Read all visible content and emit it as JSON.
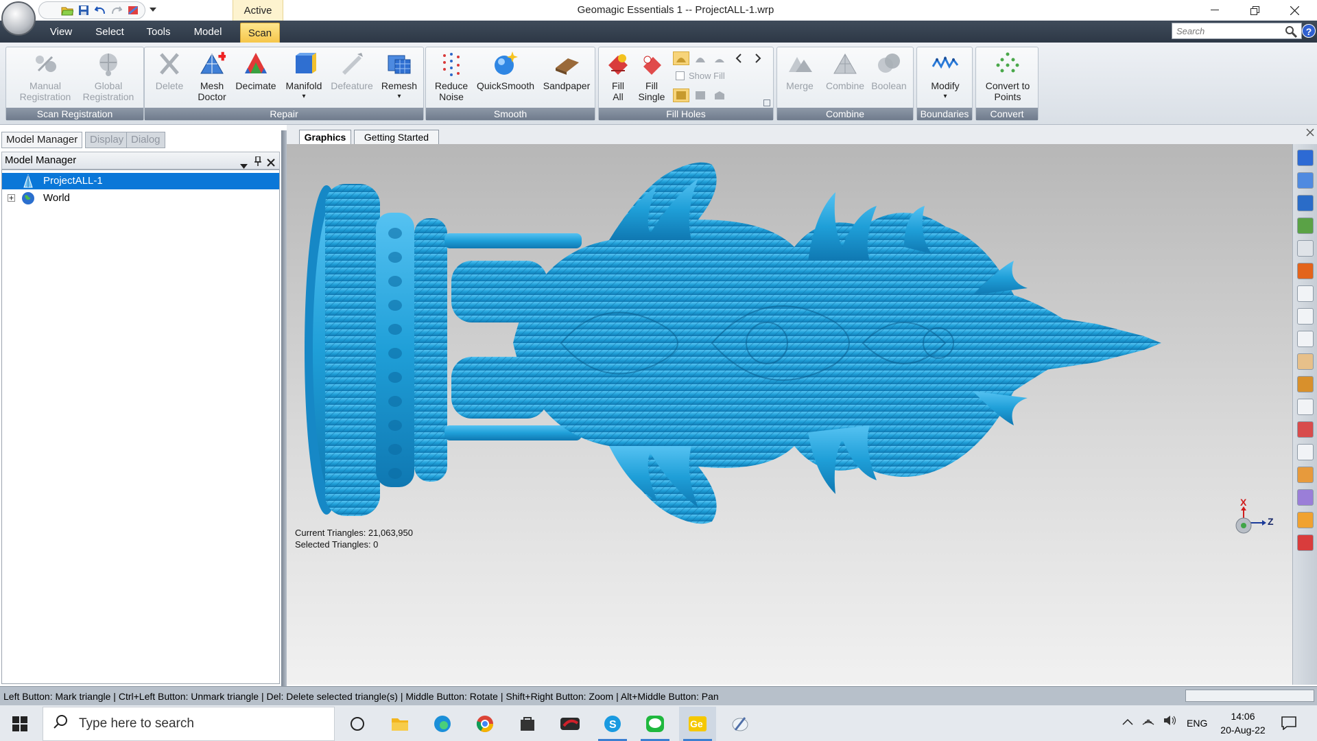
{
  "titlebar": {
    "context_tab": "Active",
    "window_title": "Geomagic Essentials 1 -- ProjectALL-1.wrp"
  },
  "menu": {
    "items": [
      "View",
      "Select",
      "Tools",
      "Model",
      "Scan"
    ],
    "selected": "Scan",
    "search_placeholder": "Search"
  },
  "ribbon": {
    "groups": [
      {
        "label": "Scan Registration",
        "buttons": [
          {
            "label": "Manual Registration",
            "line1": "Manual",
            "line2": "Registration",
            "icon": "manual-registration-icon",
            "enabled": false
          },
          {
            "label": "Global Registration",
            "line1": "Global",
            "line2": "Registration",
            "icon": "global-registration-icon",
            "enabled": false
          }
        ]
      },
      {
        "label": "Repair",
        "buttons": [
          {
            "label": "Delete",
            "line1": "Delete",
            "line2": "",
            "icon": "delete-icon",
            "enabled": false
          },
          {
            "label": "Mesh Doctor",
            "line1": "Mesh",
            "line2": "Doctor",
            "icon": "mesh-doctor-icon",
            "enabled": true
          },
          {
            "label": "Decimate",
            "line1": "Decimate",
            "line2": "",
            "icon": "decimate-icon",
            "enabled": true
          },
          {
            "label": "Manifold",
            "line1": "Manifold",
            "line2": "▾",
            "icon": "manifold-icon",
            "enabled": true
          },
          {
            "label": "Defeature",
            "line1": "Defeature",
            "line2": "",
            "icon": "defeature-icon",
            "enabled": false
          },
          {
            "label": "Remesh",
            "line1": "Remesh",
            "line2": "▾",
            "icon": "remesh-icon",
            "enabled": true
          }
        ]
      },
      {
        "label": "Smooth",
        "buttons": [
          {
            "label": "Reduce Noise",
            "line1": "Reduce",
            "line2": "Noise",
            "icon": "reduce-noise-icon",
            "enabled": true
          },
          {
            "label": "QuickSmooth",
            "line1": "QuickSmooth",
            "line2": "",
            "icon": "quicksmooth-icon",
            "enabled": true
          },
          {
            "label": "Sandpaper",
            "line1": "Sandpaper",
            "line2": "",
            "icon": "sandpaper-icon",
            "enabled": true
          }
        ]
      },
      {
        "label": "Fill Holes",
        "buttons": [
          {
            "label": "Fill All",
            "line1": "Fill",
            "line2": "All",
            "icon": "fill-all-icon",
            "enabled": true
          },
          {
            "label": "Fill Single",
            "line1": "Fill",
            "line2": "Single",
            "icon": "fill-single-icon",
            "enabled": true
          }
        ],
        "show_fill": "Show Fill"
      },
      {
        "label": "Combine",
        "buttons": [
          {
            "label": "Merge",
            "line1": "Merge",
            "line2": "",
            "icon": "merge-icon",
            "enabled": false
          },
          {
            "label": "Combine",
            "line1": "Combine",
            "line2": "",
            "icon": "combine-icon",
            "enabled": false
          },
          {
            "label": "Boolean",
            "line1": "Boolean",
            "line2": "",
            "icon": "boolean-icon",
            "enabled": false
          }
        ]
      },
      {
        "label": "Boundaries",
        "buttons": [
          {
            "label": "Modify",
            "line1": "Modify",
            "line2": "▾",
            "icon": "modify-icon",
            "enabled": true
          }
        ]
      },
      {
        "label": "Convert",
        "buttons": [
          {
            "label": "Convert to Points",
            "line1": "Convert to",
            "line2": "Points",
            "icon": "convert-to-points-icon",
            "enabled": true
          }
        ]
      }
    ]
  },
  "panel": {
    "tabs": [
      "Model Manager",
      "Display",
      "Dialog"
    ],
    "header": "Model Manager",
    "tree": [
      {
        "label": "ProjectALL-1",
        "selected": true,
        "icon": "mesh-model-icon"
      },
      {
        "label": "World",
        "selected": false,
        "icon": "globe-icon"
      }
    ]
  },
  "doc_tabs": [
    "Graphics",
    "Getting Started"
  ],
  "viewport": {
    "current_triangles": "Current Triangles: 21,063,950",
    "selected_triangles": "Selected Triangles: 0",
    "axis_x": "X",
    "axis_z": "Z",
    "model_color": "#1f9fd8"
  },
  "statusbar": {
    "hint": "Left Button: Mark triangle | Ctrl+Left Button: Unmark triangle | Del: Delete selected triangle(s) | Middle Button: Rotate | Shift+Right Button: Zoom | Alt+Middle Button: Pan"
  },
  "taskbar": {
    "search_placeholder": "Type here to search",
    "apps": [
      "task-view-icon",
      "file-explorer-icon",
      "edge-icon",
      "chrome-icon",
      "store-icon",
      "game-app-icon",
      "skype-icon",
      "line-icon",
      "geomagic-icon",
      "paint-icon"
    ],
    "language": "ENG",
    "time": "14:06",
    "date": "20-Aug-22"
  }
}
